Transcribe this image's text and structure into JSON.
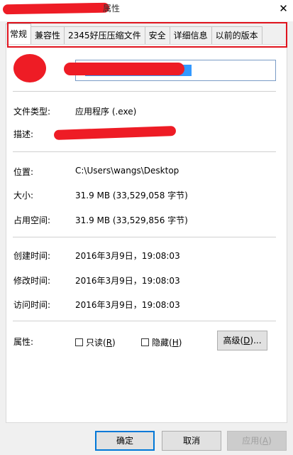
{
  "window": {
    "title_partial": "属性",
    "close_glyph": "✕"
  },
  "tabs": [
    {
      "label": "常规",
      "active": true
    },
    {
      "label": "兼容性"
    },
    {
      "label": "2345好压压缩文件"
    },
    {
      "label": "安全"
    },
    {
      "label": "详细信息"
    },
    {
      "label": "以前的版本"
    }
  ],
  "general": {
    "file_type_label": "文件类型:",
    "file_type_value": "应用程序 (.exe)",
    "description_label": "描述:",
    "location_label": "位置:",
    "location_value": "C:\\Users\\wangs\\Desktop",
    "size_label": "大小:",
    "size_value": "31.9 MB (33,529,058 字节)",
    "disk_size_label": "占用空间:",
    "disk_size_value": "31.9 MB (33,529,856 字节)",
    "created_label": "创建时间:",
    "created_value": "2016年3月9日，19:08:03",
    "modified_label": "修改时间:",
    "modified_value": "2016年3月9日，19:08:03",
    "accessed_label": "访问时间:",
    "accessed_value": "2016年3月9日，19:08:03",
    "attributes_label": "属性:",
    "readonly_text": "只读",
    "readonly_key": "R",
    "hidden_text": "隐藏",
    "hidden_key": "H",
    "advanced_text": "高级",
    "advanced_key": "D",
    "advanced_suffix": "..."
  },
  "buttons": {
    "ok": "确定",
    "cancel": "取消",
    "apply_text": "应用",
    "apply_key": "A"
  },
  "colors": {
    "redaction": "#ee1c25",
    "highlight_outline": "#e0141e",
    "selection": "#3399ff"
  }
}
